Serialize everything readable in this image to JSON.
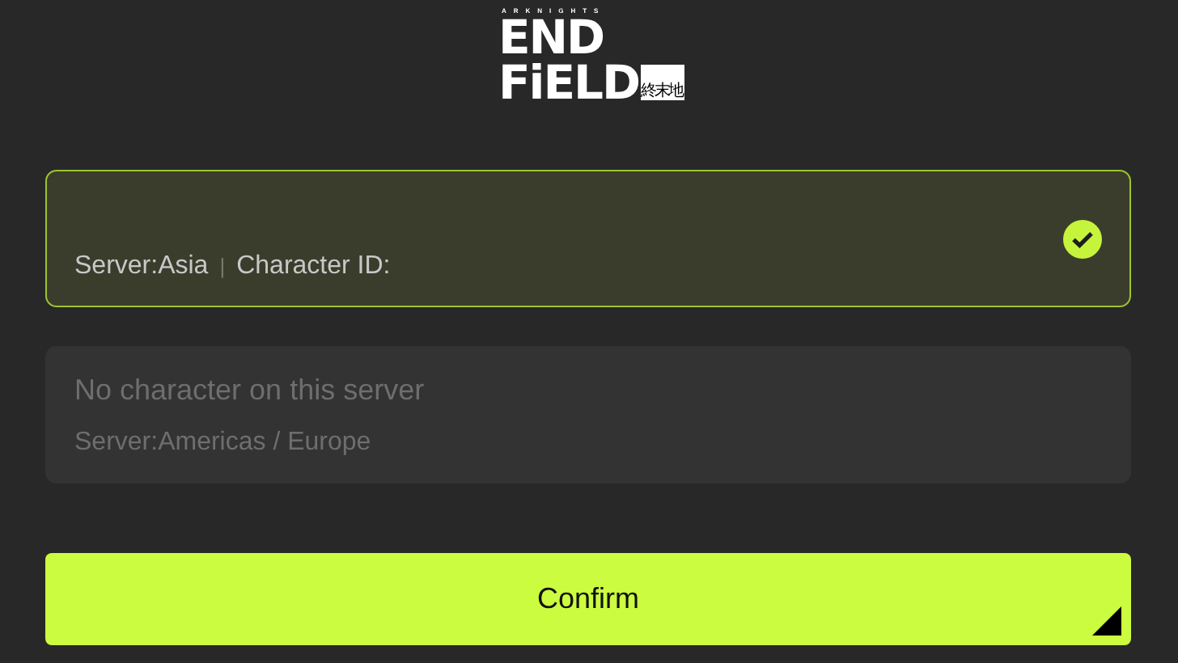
{
  "logo": {
    "top": "ARKNIGHTS",
    "line_1": "END",
    "line_2": "FiELD",
    "badge": "終末地"
  },
  "servers": [
    {
      "server": "Server:Asia",
      "separator": "|",
      "character_id": "Character ID:",
      "selected": true
    },
    {
      "title": "No character on this server",
      "server": "Server:Americas / Europe",
      "selected": false
    }
  ],
  "confirm": {
    "label": "Confirm"
  }
}
